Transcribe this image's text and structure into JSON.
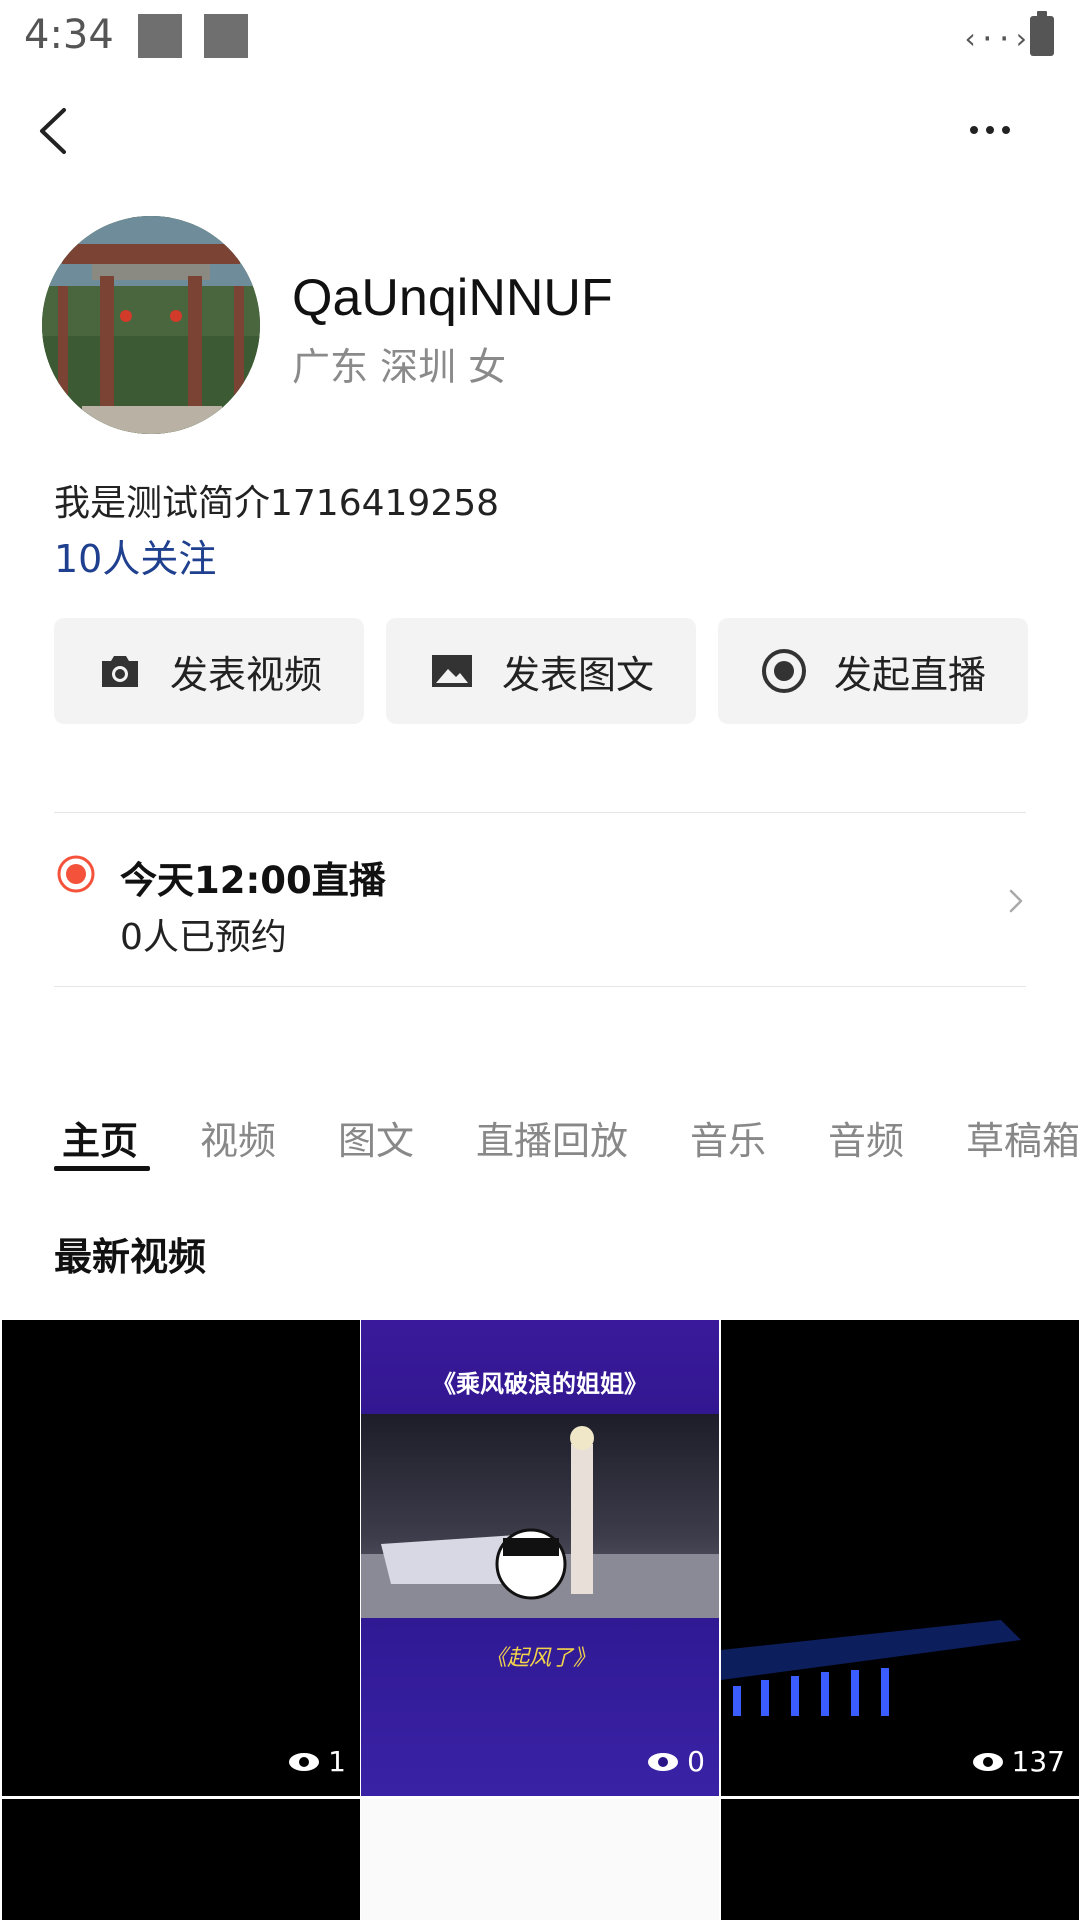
{
  "status_bar": {
    "time": "4:34",
    "signal": "‹··›"
  },
  "profile": {
    "name": "QaUnqiNNUF",
    "meta": "广东 深圳 女",
    "bio": "我是测试简介1716419258",
    "followers": "10人关注"
  },
  "actions": [
    {
      "label": "发表视频",
      "icon": "camera-icon"
    },
    {
      "label": "发表图文",
      "icon": "image-icon"
    },
    {
      "label": "发起直播",
      "icon": "record-icon"
    }
  ],
  "live": {
    "title": "今天12:00直播",
    "subtitle": "0人已预约",
    "accent": "#f4523b"
  },
  "tabs": [
    "主页",
    "视频",
    "图文",
    "直播回放",
    "音乐",
    "音频",
    "草稿箱"
  ],
  "active_tab": "主页",
  "section_title": "最新视频",
  "videos": [
    {
      "views": "1"
    },
    {
      "views": "0",
      "caption_top": "《乘风破浪的姐姐》",
      "caption_bottom": "《起风了》"
    },
    {
      "views": "137"
    }
  ]
}
